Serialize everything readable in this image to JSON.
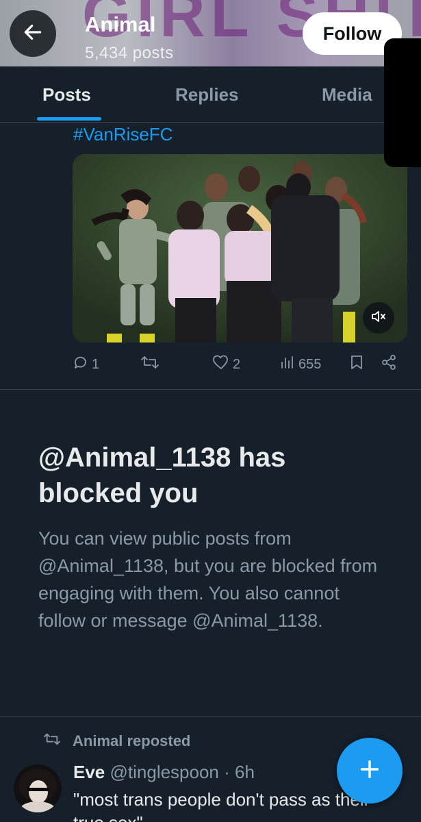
{
  "header": {
    "name": "Animal",
    "post_count": "5,434 posts",
    "follow_label": "Follow",
    "banner_text": "GIRL SHIT"
  },
  "tabs": [
    {
      "label": "Posts",
      "active": true
    },
    {
      "label": "Replies",
      "active": false
    },
    {
      "label": "Media",
      "active": false
    }
  ],
  "tweet": {
    "hashtag": "#VanRiseFC",
    "media_kind": "video",
    "mute_icon": "volume-mute-icon",
    "actions": {
      "replies": "1",
      "reposts": "",
      "likes": "2",
      "views": "655"
    }
  },
  "blocked_notice": {
    "title": "@Animal_1138 has blocked you",
    "body": "You can view public posts from @Animal_1138, but you are blocked from engaging with them. You also cannot follow or message @Animal_1138."
  },
  "repost": {
    "label": "Animal reposted",
    "author_name": "Eve",
    "author_handle": "@tinglespoon",
    "separator": "·",
    "time": "6h",
    "text": "\"most trans people don't pass as their true sex\""
  },
  "colors": {
    "background": "#15202b",
    "accent": "#1d9bf0",
    "muted_text": "#8b98a5",
    "primary_text": "#e7e9ea",
    "divider": "#38444d"
  }
}
